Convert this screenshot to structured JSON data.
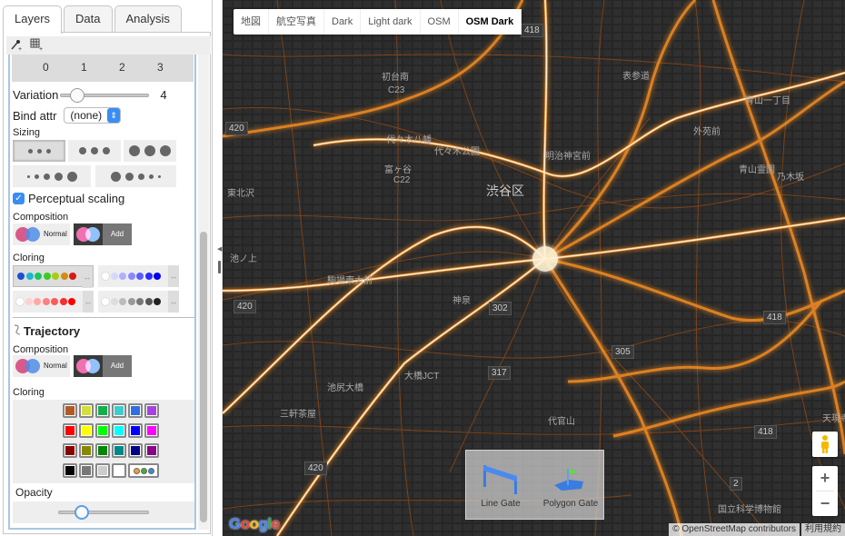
{
  "tabs": [
    {
      "label": "Layers",
      "active": true
    },
    {
      "label": "Data",
      "active": false
    },
    {
      "label": "Analysis",
      "active": false
    }
  ],
  "toolbar": {
    "icons": [
      "add-point-layer-icon",
      "add-grid-layer-icon"
    ]
  },
  "panel": {
    "tick_labels": [
      "0",
      "1",
      "2",
      "3"
    ],
    "variation": {
      "label": "Variation",
      "value": "4",
      "fraction": 0.1
    },
    "bind_attr": {
      "label": "Bind attr",
      "value": "(none)"
    },
    "sizing": {
      "label": "Sizing",
      "selected_index": 0
    },
    "perceptual_scaling": {
      "label": "Perceptual scaling",
      "checked": true
    },
    "composition": {
      "label": "Composition",
      "normal": "Normal",
      "add": "Add",
      "selected": "Add"
    },
    "coloring": {
      "label": "Cloring",
      "selected_index": 0,
      "ramps": [
        [
          "#1a4fd8",
          "#1ab8d0",
          "#17c760",
          "#38cc20",
          "#a8cc10",
          "#d88a10",
          "#d81a10"
        ],
        [
          "#ffffff",
          "#d6d6ff",
          "#b0b0ff",
          "#8888ff",
          "#5a5aff",
          "#2a2aff",
          "#0000ee"
        ],
        [
          "#ffffff",
          "#ffd0d0",
          "#ffa8a8",
          "#ff8080",
          "#ff5858",
          "#ff2a2a",
          "#ff0000"
        ],
        [
          "#ffffff",
          "#dddddd",
          "#bbbbbb",
          "#999999",
          "#777777",
          "#555555",
          "#222222"
        ]
      ],
      "swap_symbol": "↔"
    },
    "trajectory": {
      "title": "Trajectory",
      "composition": {
        "label": "Composition",
        "normal": "Normal",
        "add": "Add",
        "selected": "Add"
      },
      "coloring_label": "Cloring",
      "palette": [
        [
          "#b35a24",
          "#d4de3c",
          "#12b04a",
          "#3ecccc",
          "#2f6fe0",
          "#a640e0"
        ],
        [
          "#ff0000",
          "#ffff00",
          "#00ff00",
          "#00ffff",
          "#0000ff",
          "#ff00ff"
        ],
        [
          "#880000",
          "#888800",
          "#008800",
          "#008888",
          "#000088",
          "#880088"
        ],
        [
          "#000000",
          "#777777",
          "#cccccc",
          "#ffffff"
        ]
      ],
      "multi_swatch": [
        "#f0a030",
        "#40b040",
        "#3a8ad8"
      ],
      "opacity": {
        "label": "Opacity",
        "fraction": 0.25
      }
    }
  },
  "map": {
    "map_types": [
      {
        "label": "地図",
        "active": false
      },
      {
        "label": "航空写真",
        "active": false
      },
      {
        "label": "Dark",
        "active": false
      },
      {
        "label": "Light dark",
        "active": false
      },
      {
        "label": "OSM",
        "active": false
      },
      {
        "label": "OSM Dark",
        "active": true
      }
    ],
    "gates": {
      "line_gate": "Line Gate",
      "polygon_gate": "Polygon Gate"
    },
    "zoom_in": "+",
    "zoom_out": "−",
    "attribution": "© OpenStreetMap contributors",
    "terms": "利用規約",
    "logo": "Google",
    "labels": [
      {
        "text": "渋谷区",
        "big": true
      },
      {
        "text": "初台南"
      },
      {
        "text": "代々木八幡"
      },
      {
        "text": "代々木公園"
      },
      {
        "text": "富ヶ谷"
      },
      {
        "text": "東北沢"
      },
      {
        "text": "池ノ上"
      },
      {
        "text": "駒場東大前"
      },
      {
        "text": "神泉"
      },
      {
        "text": "大橋JCT"
      },
      {
        "text": "池尻大橋"
      },
      {
        "text": "三軒茶屋"
      },
      {
        "text": "代官山"
      },
      {
        "text": "明治神宮前"
      },
      {
        "text": "表参道"
      },
      {
        "text": "青山霊園"
      },
      {
        "text": "乃木坂"
      },
      {
        "text": "国立科学博物館"
      },
      {
        "text": "天現寺"
      },
      {
        "text": "青山一丁目"
      },
      {
        "text": "外苑前"
      }
    ],
    "shields": [
      "420",
      "420",
      "420",
      "418",
      "418",
      "418",
      "317",
      "305",
      "302",
      "2",
      "C22",
      "C23"
    ]
  }
}
